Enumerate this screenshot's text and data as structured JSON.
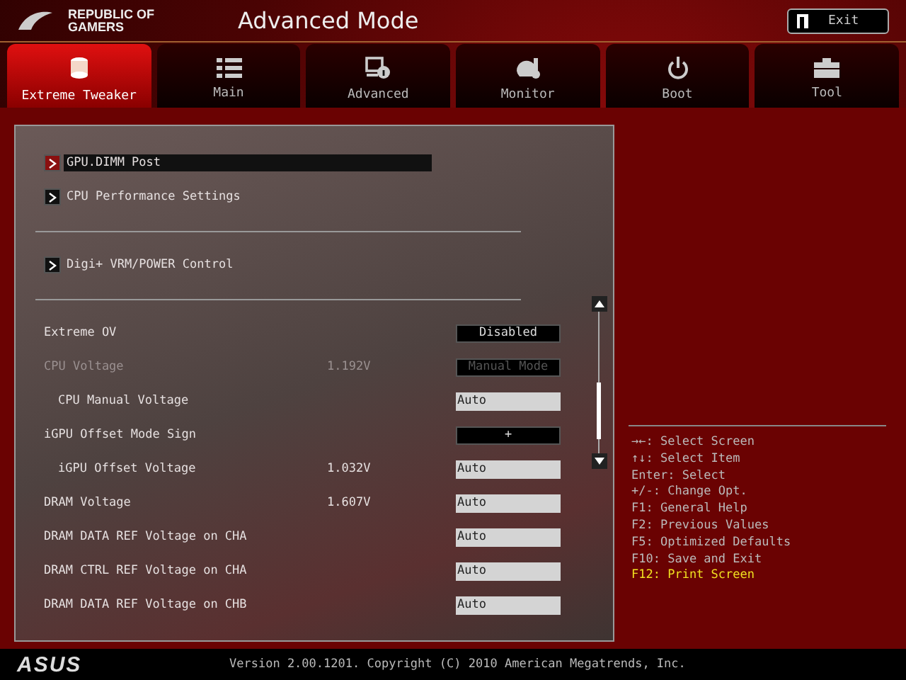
{
  "header": {
    "brand": "REPUBLIC OF GAMERS",
    "title": "Advanced Mode",
    "exit_button": "Exit"
  },
  "tabs": [
    {
      "label": "Extreme Tweaker",
      "selected": true
    },
    {
      "label": "Main",
      "selected": false
    },
    {
      "label": "Advanced",
      "selected": false
    },
    {
      "label": "Monitor",
      "selected": false
    },
    {
      "label": "Boot",
      "selected": false
    },
    {
      "label": "Tool",
      "selected": false
    }
  ],
  "items": [
    {
      "kind": "submenu",
      "label": "GPU.DIMM Post",
      "selected": true
    },
    {
      "kind": "submenu",
      "label": "CPU Performance Settings",
      "selected": false
    },
    {
      "kind": "divider"
    },
    {
      "kind": "submenu",
      "label": "Digi+ VRM/POWER Control",
      "selected": false
    },
    {
      "kind": "divider"
    },
    {
      "kind": "setting",
      "label": "Extreme OV",
      "field": {
        "kind": "option",
        "value": "Disabled"
      },
      "disabled": false
    },
    {
      "kind": "setting",
      "label": "CPU Voltage",
      "reading": "1.192V",
      "field": {
        "kind": "option",
        "value": "Manual Mode"
      },
      "disabled": true,
      "children": [
        {
          "kind": "setting",
          "label": "CPU Manual Voltage",
          "field": {
            "kind": "input",
            "value": "Auto"
          },
          "disabled": false
        }
      ]
    },
    {
      "kind": "setting",
      "label": "iGPU Offset Mode Sign",
      "field": {
        "kind": "option",
        "value": "+"
      },
      "disabled": false,
      "children": [
        {
          "kind": "setting",
          "label": "iGPU Offset Voltage",
          "reading": "1.032V",
          "field": {
            "kind": "input",
            "value": "Auto"
          },
          "disabled": false
        }
      ]
    },
    {
      "kind": "setting",
      "label": "DRAM Voltage",
      "reading": "1.607V",
      "field": {
        "kind": "input",
        "value": "Auto"
      },
      "disabled": false
    },
    {
      "kind": "setting",
      "label": "DRAM DATA REF Voltage on CHA",
      "field": {
        "kind": "input",
        "value": "Auto"
      },
      "disabled": false
    },
    {
      "kind": "setting",
      "label": "DRAM CTRL REF Voltage on CHA",
      "field": {
        "kind": "input",
        "value": "Auto"
      },
      "disabled": false
    },
    {
      "kind": "setting",
      "label": "DRAM DATA REF Voltage on CHB",
      "field": {
        "kind": "input",
        "value": "Auto"
      },
      "disabled": false
    }
  ],
  "help": [
    {
      "text": "→←: Select Screen",
      "highlighted": false
    },
    {
      "text": "↑↓: Select Item",
      "highlighted": false
    },
    {
      "text": "Enter: Select",
      "highlighted": false
    },
    {
      "text": "+/-: Change Opt.",
      "highlighted": false
    },
    {
      "text": "F1: General Help",
      "highlighted": false
    },
    {
      "text": "F2: Previous Values",
      "highlighted": false
    },
    {
      "text": "F5: Optimized Defaults",
      "highlighted": false
    },
    {
      "text": "F10: Save and Exit",
      "highlighted": false
    },
    {
      "text": "F12: Print Screen",
      "highlighted": true
    }
  ],
  "footer": {
    "logo": "ASUS",
    "version": "Version 2.00.1201. Copyright (C) 2010 American Megatrends, Inc."
  }
}
